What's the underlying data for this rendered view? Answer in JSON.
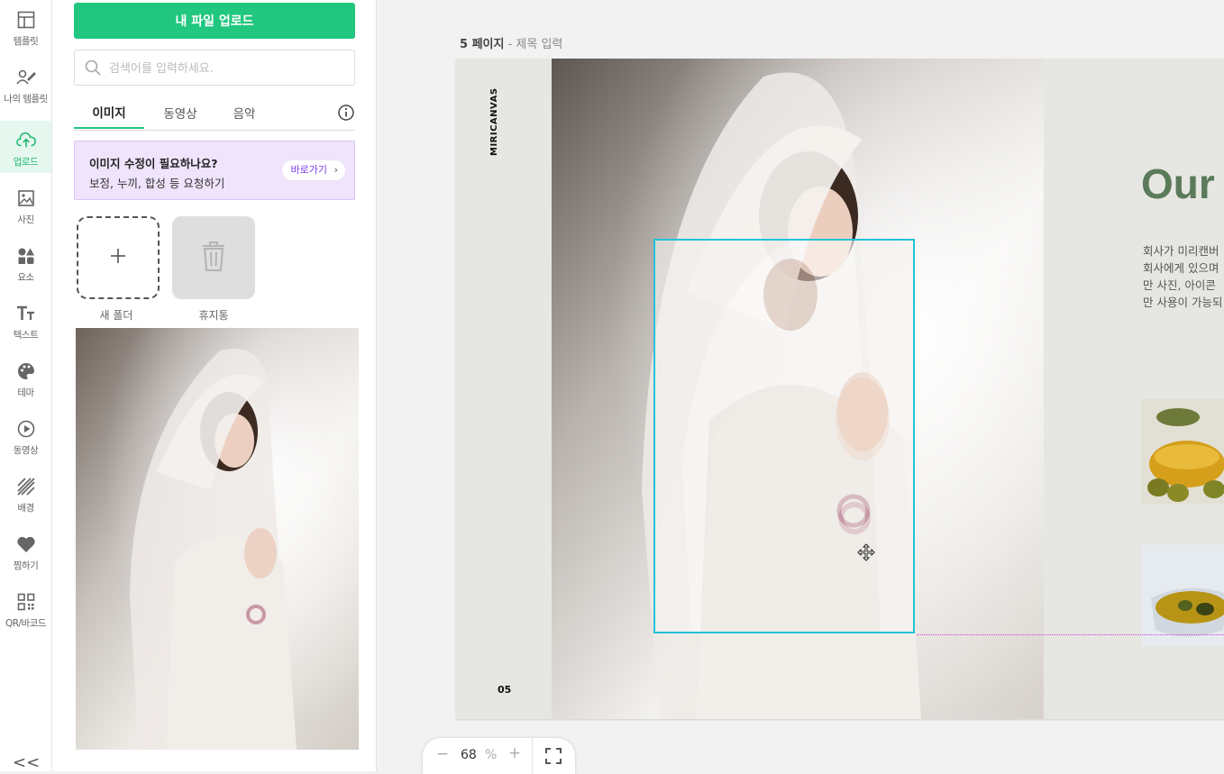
{
  "rail": {
    "items": [
      {
        "label": "템플릿",
        "icon": "layout-icon"
      },
      {
        "label": "나의 템플릿",
        "icon": "my-template-icon"
      },
      {
        "label": "업로드",
        "icon": "cloud-upload-icon",
        "active": true
      },
      {
        "label": "사진",
        "icon": "photo-icon"
      },
      {
        "label": "요소",
        "icon": "shapes-icon"
      },
      {
        "label": "텍스트",
        "icon": "text-icon"
      },
      {
        "label": "테마",
        "icon": "palette-icon"
      },
      {
        "label": "동영상",
        "icon": "play-icon"
      },
      {
        "label": "배경",
        "icon": "background-icon"
      },
      {
        "label": "찜하기",
        "icon": "heart-icon"
      },
      {
        "label": "QR/바코드",
        "icon": "qr-icon"
      }
    ],
    "collapse": "<<"
  },
  "panel": {
    "upload_button": "내 파일 업로드",
    "search_placeholder": "검색어를 입력하세요.",
    "tabs": [
      "이미지",
      "동영상",
      "음악"
    ],
    "active_tab": "이미지",
    "promo": {
      "title": "이미지 수정이 필요하나요?",
      "subtitle": "보정, 누끼, 합성 등 요청하기",
      "button": "바로가기"
    },
    "new_folder_label": "새 폴더",
    "trash_label": "휴지통"
  },
  "canvas": {
    "page_title": "5 페이지",
    "page_subtitle": "- 제목 입력",
    "brand": "MIRICANVAS",
    "page_number": "05",
    "heading": "Our",
    "body_lines": [
      "회사가 미리캔버",
      "회사에게 있으며",
      "만 사진, 아이콘",
      "만 사용이 가능되"
    ]
  },
  "zoom": {
    "minus": "−",
    "value": "68",
    "unit": "%",
    "plus": "+"
  },
  "colors": {
    "accent": "#22c77f",
    "heading": "#5b7a5a",
    "selection": "#22c3d6",
    "guide": "#d23bd0",
    "promo_bg": "#efe4fc"
  }
}
